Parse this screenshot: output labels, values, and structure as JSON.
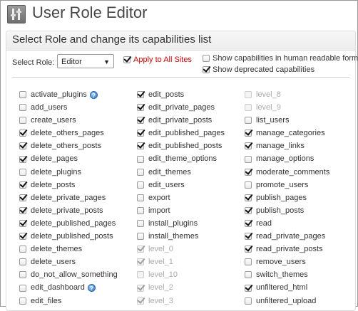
{
  "header": {
    "title": "User Role Editor",
    "icon": "tools-icon"
  },
  "panel": {
    "title": "Select Role and change its capabilities list"
  },
  "role_select": {
    "label": "Select Role:",
    "value": "Editor"
  },
  "options": {
    "apply_all": {
      "label": "Apply to All Sites",
      "checked": true,
      "color": "#cc0000"
    },
    "human_readable": {
      "label": "Show capabilities in human readable form",
      "checked": false
    },
    "deprecated": {
      "label": "Show deprecated capabilities",
      "checked": true
    }
  },
  "columns": [
    [
      {
        "label": "activate_plugins",
        "checked": false,
        "disabled": false,
        "help": true
      },
      {
        "label": "add_users",
        "checked": false,
        "disabled": false
      },
      {
        "label": "create_users",
        "checked": false,
        "disabled": false
      },
      {
        "label": "delete_others_pages",
        "checked": true,
        "disabled": false
      },
      {
        "label": "delete_others_posts",
        "checked": true,
        "disabled": false
      },
      {
        "label": "delete_pages",
        "checked": true,
        "disabled": false
      },
      {
        "label": "delete_plugins",
        "checked": false,
        "disabled": false
      },
      {
        "label": "delete_posts",
        "checked": true,
        "disabled": false
      },
      {
        "label": "delete_private_pages",
        "checked": true,
        "disabled": false
      },
      {
        "label": "delete_private_posts",
        "checked": true,
        "disabled": false
      },
      {
        "label": "delete_published_pages",
        "checked": true,
        "disabled": false
      },
      {
        "label": "delete_published_posts",
        "checked": true,
        "disabled": false
      },
      {
        "label": "delete_themes",
        "checked": false,
        "disabled": false
      },
      {
        "label": "delete_users",
        "checked": false,
        "disabled": false
      },
      {
        "label": "do_not_allow_something",
        "checked": false,
        "disabled": false
      },
      {
        "label": "edit_dashboard",
        "checked": false,
        "disabled": false,
        "help": true
      },
      {
        "label": "edit_files",
        "checked": false,
        "disabled": false
      }
    ],
    [
      {
        "label": "edit_posts",
        "checked": true,
        "disabled": false
      },
      {
        "label": "edit_private_pages",
        "checked": true,
        "disabled": false
      },
      {
        "label": "edit_private_posts",
        "checked": true,
        "disabled": false
      },
      {
        "label": "edit_published_pages",
        "checked": true,
        "disabled": false
      },
      {
        "label": "edit_published_posts",
        "checked": true,
        "disabled": false
      },
      {
        "label": "edit_theme_options",
        "checked": false,
        "disabled": false
      },
      {
        "label": "edit_themes",
        "checked": false,
        "disabled": false
      },
      {
        "label": "edit_users",
        "checked": false,
        "disabled": false
      },
      {
        "label": "export",
        "checked": false,
        "disabled": false
      },
      {
        "label": "import",
        "checked": false,
        "disabled": false
      },
      {
        "label": "install_plugins",
        "checked": false,
        "disabled": false
      },
      {
        "label": "install_themes",
        "checked": false,
        "disabled": false
      },
      {
        "label": "level_0",
        "checked": true,
        "disabled": true
      },
      {
        "label": "level_1",
        "checked": true,
        "disabled": true
      },
      {
        "label": "level_10",
        "checked": false,
        "disabled": true
      },
      {
        "label": "level_2",
        "checked": true,
        "disabled": true
      },
      {
        "label": "level_3",
        "checked": true,
        "disabled": true
      }
    ],
    [
      {
        "label": "level_8",
        "checked": false,
        "disabled": true
      },
      {
        "label": "level_9",
        "checked": false,
        "disabled": true
      },
      {
        "label": "list_users",
        "checked": false,
        "disabled": false
      },
      {
        "label": "manage_categories",
        "checked": true,
        "disabled": false
      },
      {
        "label": "manage_links",
        "checked": true,
        "disabled": false
      },
      {
        "label": "manage_options",
        "checked": false,
        "disabled": false
      },
      {
        "label": "moderate_comments",
        "checked": true,
        "disabled": false
      },
      {
        "label": "promote_users",
        "checked": false,
        "disabled": false
      },
      {
        "label": "publish_pages",
        "checked": true,
        "disabled": false
      },
      {
        "label": "publish_posts",
        "checked": true,
        "disabled": false
      },
      {
        "label": "read",
        "checked": true,
        "disabled": false
      },
      {
        "label": "read_private_pages",
        "checked": true,
        "disabled": false
      },
      {
        "label": "read_private_posts",
        "checked": true,
        "disabled": false
      },
      {
        "label": "remove_users",
        "checked": false,
        "disabled": false
      },
      {
        "label": "switch_themes",
        "checked": false,
        "disabled": false
      },
      {
        "label": "unfiltered_html",
        "checked": true,
        "disabled": false
      },
      {
        "label": "unfiltered_upload",
        "checked": false,
        "disabled": false
      }
    ]
  ]
}
